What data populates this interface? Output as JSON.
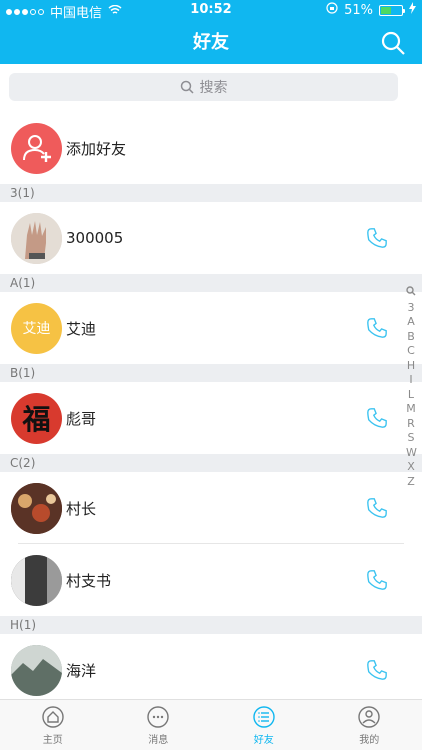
{
  "status": {
    "carrier": "中国电信",
    "time": "10:52",
    "battery_percent": "51%",
    "battery_level": 0.51,
    "signal_dots_filled": 3
  },
  "header": {
    "title": "好友",
    "search_icon": "search-icon"
  },
  "search": {
    "placeholder": "搜索"
  },
  "add_friend": {
    "label": "添加好友",
    "icon": "add-user-icon",
    "color": "#ef5b5b"
  },
  "sections": [
    {
      "header": "3(1)",
      "contacts": [
        {
          "name": "300005",
          "avatar_color": "#cfc6be"
        }
      ]
    },
    {
      "header": "A(1)",
      "contacts": [
        {
          "name": "艾迪",
          "avatar_text": "艾迪",
          "avatar_color": "#f6c244"
        }
      ]
    },
    {
      "header": "B(1)",
      "contacts": [
        {
          "name": "彪哥",
          "avatar_text": "福",
          "avatar_color": "#d83a2e"
        }
      ]
    },
    {
      "header": "C(2)",
      "contacts": [
        {
          "name": "村长",
          "avatar_color": "#6b3a2a"
        },
        {
          "name": "村支书",
          "avatar_color": "#444"
        }
      ]
    },
    {
      "header": "H(1)",
      "contacts": [
        {
          "name": "海洋",
          "avatar_color": "#7d8d86"
        }
      ]
    }
  ],
  "index_letters": [
    "3",
    "A",
    "B",
    "C",
    "H",
    "I",
    "L",
    "M",
    "R",
    "S",
    "W",
    "X",
    "Z"
  ],
  "tabs": [
    {
      "label": "主页",
      "icon": "home-icon",
      "active": false
    },
    {
      "label": "消息",
      "icon": "chat-icon",
      "active": false
    },
    {
      "label": "好友",
      "icon": "list-icon",
      "active": true
    },
    {
      "label": "我的",
      "icon": "profile-icon",
      "active": false
    }
  ],
  "colors": {
    "accent": "#10b7f0",
    "phone_icon": "#3cc3f0"
  }
}
